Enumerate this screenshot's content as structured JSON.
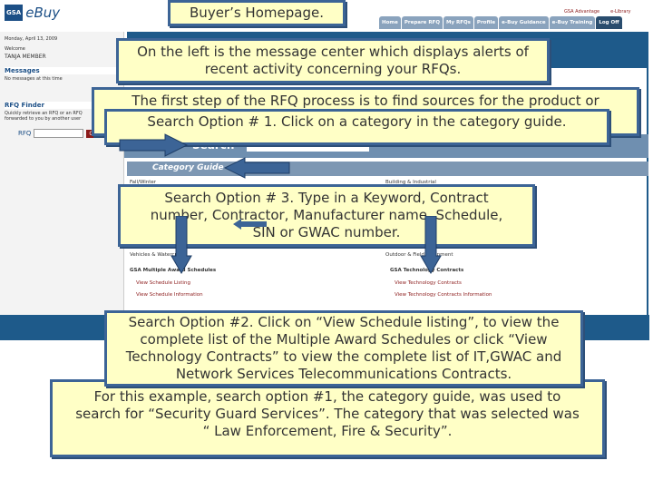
{
  "app": {
    "logo_box": "GSA",
    "logo_name": "eBuy"
  },
  "top_links": [
    "GSA Advantage",
    "e-Library"
  ],
  "tabs": [
    "Home",
    "Prepare RFQ",
    "My RFQs",
    "Profile",
    "e-Buy Guidance",
    "e-Buy Training",
    "Log Off"
  ],
  "left": {
    "date": "Monday, April 13, 2009",
    "welcome": "Welcome",
    "user": "TANJA MEMBER",
    "messages_header": "Messages",
    "messages_text": "No messages at this time",
    "rfq_header": "RFQ Finder",
    "rfq_text": "Quickly retrieve an RFQ or an RFQ forwarded to you by another user",
    "rfq_label": "RFQ",
    "go": "Go"
  },
  "main": {
    "search_label": "Search",
    "category_guide": "Category Guide",
    "cat1": "Fall/Winter",
    "cat2": "Building & Industrial",
    "cat3": "Vehicles & Watercraft",
    "cat4": "Outdoor & Field Equipment",
    "mas_header": "GSA Multiple Award Schedules",
    "mas_links": [
      "View Schedule Listing",
      "View Schedule Information"
    ],
    "tech_header": "GSA Technology Contracts",
    "tech_links": [
      "View Technology Contracts",
      "View Technology Contracts Information"
    ]
  },
  "callouts": {
    "title": "Buyer’s Homepage.",
    "message_center": "On the left is the message center which displays alerts of recent activity concerning your RFQs.",
    "first_step": "The first step of the RFQ process is to find sources for the product or",
    "option1": "Search Option # 1. Click on a category in the category guide.",
    "option3": "Search Option # 3. Type in a Keyword, Contract number, Contractor, Manufacturer name, Schedule, SIN or GWAC number.",
    "option2": "Search Option #2. Click on “View Schedule listing”, to view the complete list of the Multiple Award Schedules or click “View Technology Contracts” to view the complete list of IT,GWAC and Network Services Telecommunications Contracts.",
    "example": "For this example, search option #1, the category guide, was used to search for “Security Guard Services”. The category that was selected was “ Law Enforcement, Fire & Security”."
  },
  "colors": {
    "callout_fill": "#ffffc6",
    "callout_border": "#3c6496",
    "brand_blue": "#1e5a8a"
  }
}
